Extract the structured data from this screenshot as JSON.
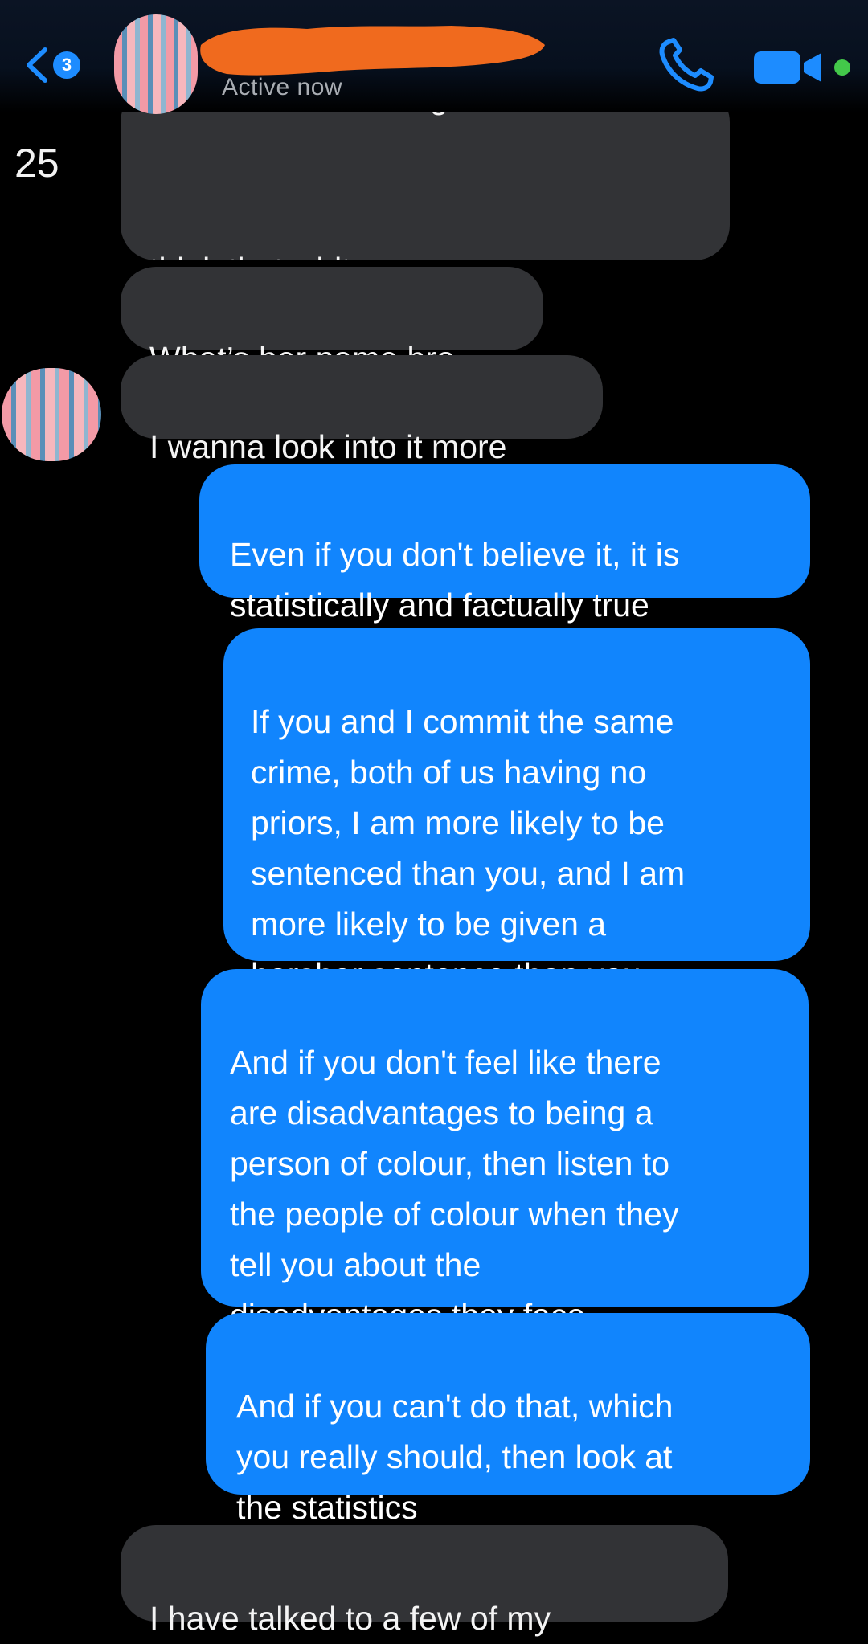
{
  "header": {
    "back_badge": "3",
    "status": "Active now",
    "icons": {
      "back": "chevron-left-icon",
      "call": "phone-icon",
      "video": "video-camera-icon"
    },
    "accent_color": "#1d8cff",
    "online_color": "#43c84a",
    "redaction_color": "#f06a1e"
  },
  "sidebar": {
    "count": "25"
  },
  "messages": [
    {
      "direction": "incoming",
      "clipped_text": "are at a disadvantage tho and I",
      "text": "think that white woman was\nwrong"
    },
    {
      "direction": "incoming",
      "text": "What’s her name bro"
    },
    {
      "direction": "incoming",
      "text": "I wanna look into it more"
    },
    {
      "direction": "outgoing",
      "text": "Even if you don't believe it, it is\nstatistically and factually true"
    },
    {
      "direction": "outgoing",
      "text": "If you and I commit the same\ncrime, both of us having no\npriors, I am more likely to be\nsentenced than you, and I am\nmore likely to be given a\nharsher sentence than you"
    },
    {
      "direction": "outgoing",
      "text": "And if you don't feel like there\nare disadvantages to being a\nperson of colour, then listen to\nthe people of colour when they\ntell you about the\ndisadvantages they face"
    },
    {
      "direction": "outgoing",
      "text": "And if you can't do that, which\nyou really should, then look at\nthe statistics"
    },
    {
      "direction": "incoming",
      "text": "I have talked to a few of my"
    }
  ],
  "colors": {
    "incoming_bubble": "#323336",
    "outgoing_bubble": "#1185fd",
    "background": "#000000"
  }
}
